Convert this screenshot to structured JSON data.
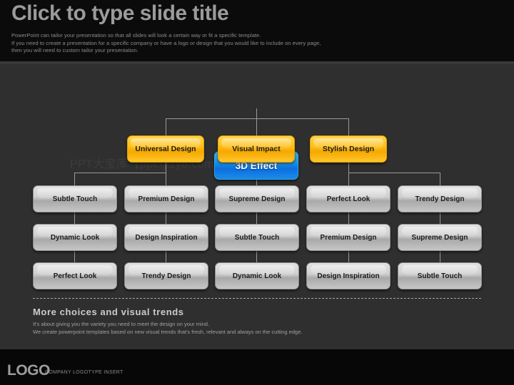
{
  "slide": {
    "title": "Click to type slide title",
    "header_body": "PowerPoint can tailor your presentation so that all slides will look a certain way or fit a specific template.\nIf you need to create a presentation for a specific company or have a logo or design that you would like to include on every page,\nthen you will need to custom tailor your presentation.",
    "watermark": "PPT大宝库【ppt.glzy8.com】"
  },
  "diagram": {
    "root": {
      "label": "3D Effect",
      "color": "#1796e6"
    },
    "branches": [
      {
        "label": "Universal Design",
        "color": "#ffbf16"
      },
      {
        "label": "Visual Impact",
        "color": "#ffbf16"
      },
      {
        "label": "Stylish  Design",
        "color": "#ffbf16"
      }
    ],
    "leaf_rows": [
      [
        "Subtle Touch",
        "Premium Design",
        "Supreme Design",
        "Perfect Look",
        "Trendy Design"
      ],
      [
        "Dynamic Look",
        "Design Inspiration",
        "Subtle Touch",
        "Premium Design",
        "Supreme Design"
      ],
      [
        "Perfect Look",
        "Trendy Design",
        "Dynamic Look",
        "Design Inspiration",
        "Subtle Touch"
      ]
    ],
    "leaf_color": "#c6c6c6"
  },
  "footer_block": {
    "heading": "More  choices  and  visual  trends",
    "line1": "It's about giving you the variety you need to meet the design on your mind.",
    "line2": "We create powerpoint templates based on new visual trends that's fresh, relevant and always on the cutting edge."
  },
  "bottom_bar": {
    "logo": "LOGO",
    "logo_subtitle": "COMPANY LOGOTYPE  INSERT"
  }
}
